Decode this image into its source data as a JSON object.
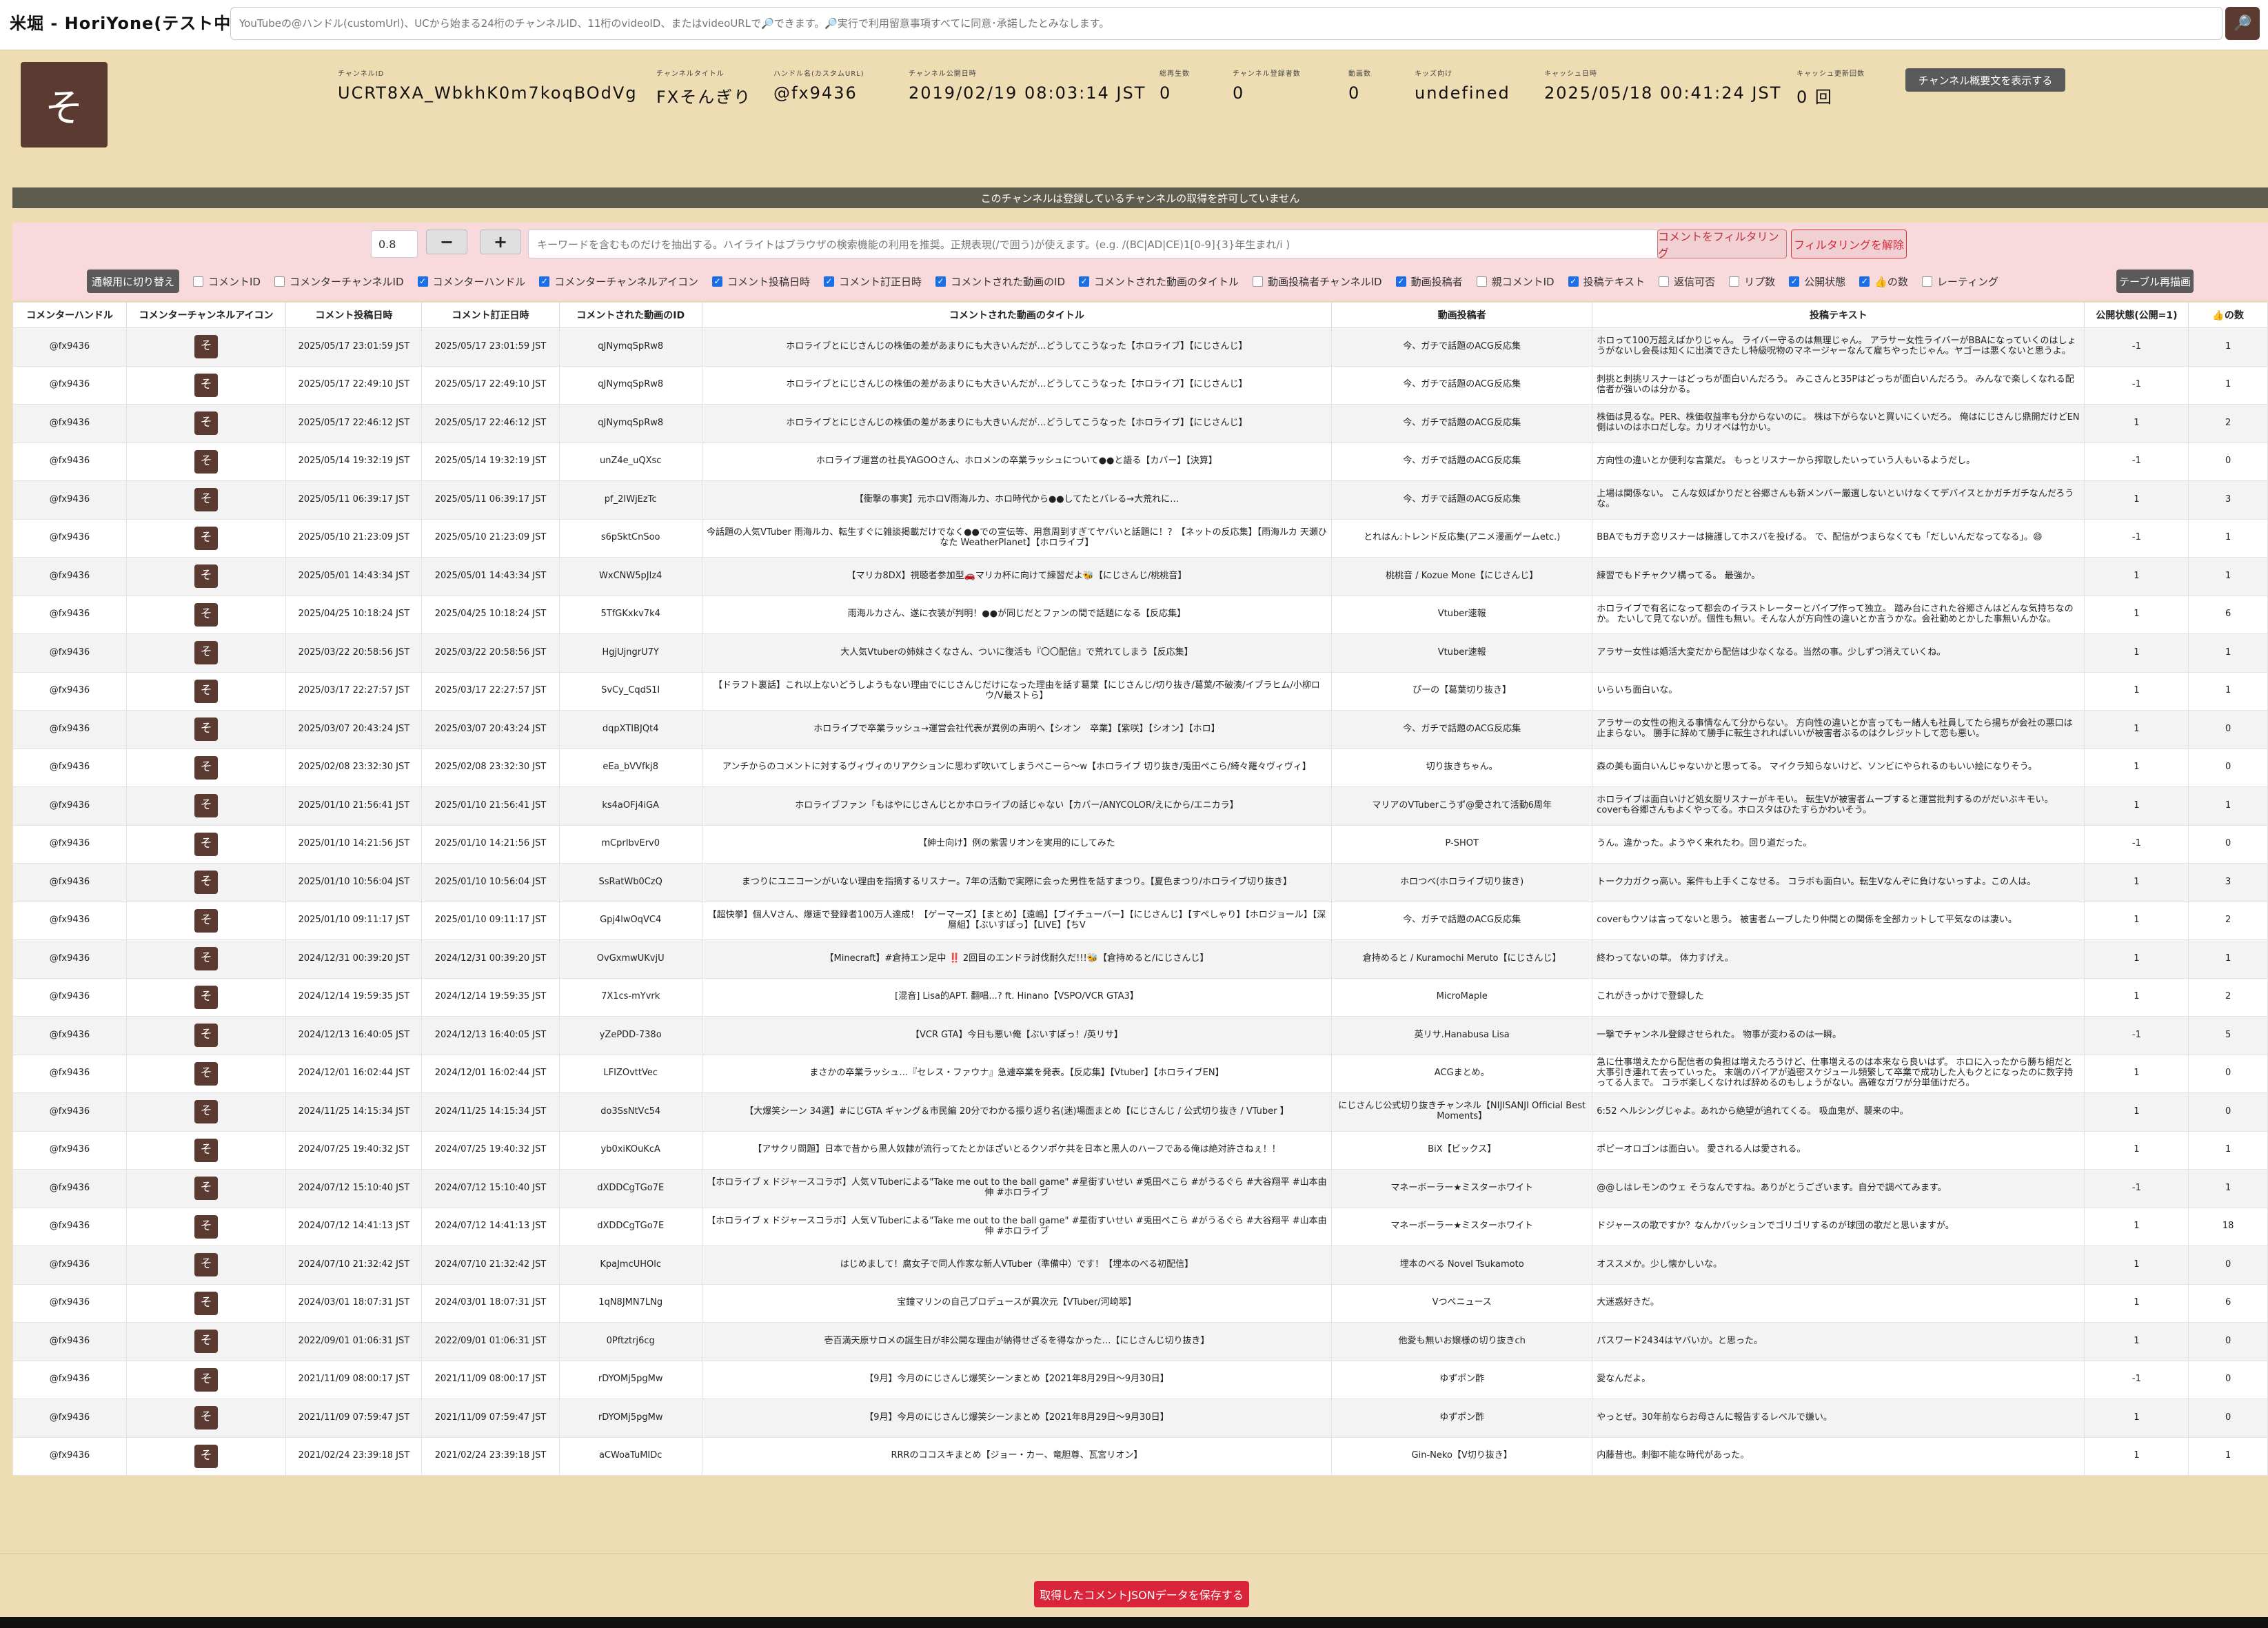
{
  "app_title": "米堀 - HoriYone(テスト中)",
  "search": {
    "placeholder": "YouTubeの@ハンドル(customUrl)、UCから始まる24桁のチャンネルID、11桁のvideoID、またはvideoURLで🔎できます。🔎実行で利用留意事項すべてに同意･承諾したとみなします。",
    "button_icon": "🔎"
  },
  "channel": {
    "avatar_char": "そ",
    "fields": [
      {
        "label": "チャンネルID",
        "value": "UCRT8XA_WbkhK0m7koqBOdVg"
      },
      {
        "label": "チャンネルタイトル",
        "value": "FXそんぎり"
      },
      {
        "label": "ハンドル名(カスタムURL)",
        "value": "@fx9436"
      },
      {
        "label": "チャンネル公開日時",
        "value": "2019/02/19 08:03:14 JST"
      },
      {
        "label": "総再生数",
        "value": "0"
      },
      {
        "label": "チャンネル登録者数",
        "value": "0"
      },
      {
        "label": "動画数",
        "value": "0"
      },
      {
        "label": "キッズ向け",
        "value": "undefined"
      },
      {
        "label": "キャッシュ日時",
        "value": "2025/05/18 00:41:24 JST"
      },
      {
        "label": "キャッシュ更新回数",
        "value": "0 回"
      }
    ],
    "summary_button": "チャンネル概要文を表示する"
  },
  "notice": "このチャンネルは登録しているチャンネルの取得を許可していません",
  "filter": {
    "zoom_value": "0.8",
    "minus_label": "−",
    "plus_label": "+",
    "keyword_placeholder": "キーワードを含むものだけを抽出する。ハイライトはブラウザの検索機能の利用を推奨。正規表現(/で囲う)が使えます。(e.g. /(BC|AD|CE)1[0-9]{3}年生まれ/i )",
    "filter_button": "コメントをフィルタリング",
    "clear_button": "フィルタリングを解除",
    "toggle_button": "通報用に切り替え",
    "redraw_button": "テーブル再描画",
    "columns": [
      {
        "label": "コメントID",
        "checked": false
      },
      {
        "label": "コメンターチャンネルID",
        "checked": false
      },
      {
        "label": "コメンターハンドル",
        "checked": true
      },
      {
        "label": "コメンターチャンネルアイコン",
        "checked": true
      },
      {
        "label": "コメント投稿日時",
        "checked": true
      },
      {
        "label": "コメント訂正日時",
        "checked": true
      },
      {
        "label": "コメントされた動画のID",
        "checked": true
      },
      {
        "label": "コメントされた動画のタイトル",
        "checked": true
      },
      {
        "label": "動画投稿者チャンネルID",
        "checked": false
      },
      {
        "label": "動画投稿者",
        "checked": true
      },
      {
        "label": "親コメントID",
        "checked": false
      },
      {
        "label": "投稿テキスト",
        "checked": true
      },
      {
        "label": "返信可否",
        "checked": false
      },
      {
        "label": "リプ数",
        "checked": false
      },
      {
        "label": "公開状態",
        "checked": true
      },
      {
        "label": "👍の数",
        "checked": true
      },
      {
        "label": "レーティング",
        "checked": false
      }
    ]
  },
  "table": {
    "headers": [
      "コメンターハンドル",
      "コメンターチャンネルアイコン",
      "コメント投稿日時",
      "コメント訂正日時",
      "コメントされた動画のID",
      "コメントされた動画のタイトル",
      "動画投稿者",
      "投稿テキスト",
      "公開状態(公開=1)",
      "👍の数"
    ],
    "rows": [
      {
        "handle": "@fx9436",
        "icon": "そ",
        "posted": "2025/05/17 23:01:59 JST",
        "edited": "2025/05/17 23:01:59 JST",
        "video_id": "qJNymqSpRw8",
        "title": "ホロライブとにじさんじの株価の差があまりにも大きいんだが…どうしてこうなった【ホロライブ】【にじさんじ】",
        "uploader": "今、ガチで話題のACG反応集",
        "text": "ホロって100万超えばかりじゃん。 ライバー守るのは無理じゃん。 アラサー女性ライバーがBBAになっていくのはしょうがないし会長は知くに出演できたし特級呪物のマネージャーなんて雇ちやったじゃん。ヤゴーは悪くないと思うよ。",
        "status": "-1",
        "likes": "1"
      },
      {
        "handle": "@fx9436",
        "icon": "そ",
        "posted": "2025/05/17 22:49:10 JST",
        "edited": "2025/05/17 22:49:10 JST",
        "video_id": "qJNymqSpRw8",
        "title": "ホロライブとにじさんじの株価の差があまりにも大きいんだが…どうしてこうなった【ホロライブ】【にじさんじ】",
        "uploader": "今、ガチで話題のACG反応集",
        "text": "刺挑と刺挑リスナーはどっちが面白いんだろう。 みこさんと35Pはどっちが面白いんだろう。 みんなで楽しくなれる配信者が強いのは分かる。",
        "status": "-1",
        "likes": "1"
      },
      {
        "handle": "@fx9436",
        "icon": "そ",
        "posted": "2025/05/17 22:46:12 JST",
        "edited": "2025/05/17 22:46:12 JST",
        "video_id": "qJNymqSpRw8",
        "title": "ホロライブとにじさんじの株価の差があまりにも大きいんだが…どうしてこうなった【ホロライブ】【にじさんじ】",
        "uploader": "今、ガチで話題のACG反応集",
        "text": "株価は見るな。PER、株価収益率も分からないのに。 株は下がらないと買いにくいだろ。 俺はにじさんじ鼎開だけどEN側はいのはホロだしな。カリオペは竹かい。",
        "status": "1",
        "likes": "2"
      },
      {
        "handle": "@fx9436",
        "icon": "そ",
        "posted": "2025/05/14 19:32:19 JST",
        "edited": "2025/05/14 19:32:19 JST",
        "video_id": "unZ4e_uQXsc",
        "title": "ホロライブ運営の社長YAGOOさん、ホロメンの卒業ラッシュについて●●と語る【カバー】【決算】",
        "uploader": "今、ガチで話題のACG反応集",
        "text": "方向性の違いとか便利な言葉だ。 もっとリスナーから搾取したいっていう人もいるようだし。",
        "status": "-1",
        "likes": "0"
      },
      {
        "handle": "@fx9436",
        "icon": "そ",
        "posted": "2025/05/11 06:39:17 JST",
        "edited": "2025/05/11 06:39:17 JST",
        "video_id": "pf_2IWjEzTc",
        "title": "【衝撃の事実】元ホロV雨海ルカ、ホロ時代から●●してたとバレる→大荒れに…",
        "uploader": "今、ガチで話題のACG反応集",
        "text": "上場は関係ない。 こんな奴ばかりだと谷郷さんも新メンバー厳選しないといけなくてデバイスとかガチガチなんだろうな。",
        "status": "1",
        "likes": "3"
      },
      {
        "handle": "@fx9436",
        "icon": "そ",
        "posted": "2025/05/10 21:23:09 JST",
        "edited": "2025/05/10 21:23:09 JST",
        "video_id": "s6pSktCnSoo",
        "title": "今話題の人気VTuber 雨海ルカ、転生すぐに雑談掲載だけでなく●●での宣伝等、用意周到すぎてヤバいと話題に！？【ネットの反応集】【雨海ルカ 天瀬ひなた WeatherPlanet】【ホロライブ】",
        "uploader": "とれはん:トレンド反応集(アニメ漫画ゲームetc.)",
        "text": "BBAでもガチ恋リスナーは擁護してホスバを投げる。 で、配信がつまらなくても「だしいんだなってなる」。😄",
        "status": "-1",
        "likes": "1"
      },
      {
        "handle": "@fx9436",
        "icon": "そ",
        "posted": "2025/05/01 14:43:34 JST",
        "edited": "2025/05/01 14:43:34 JST",
        "video_id": "WxCNW5pJlz4",
        "title": "【マリカ8DX】視聴者参加型🚗マリカ杯に向けて練習だよ🐝【にじさんじ/桃桃音】",
        "uploader": "桃桃音 / Kozue Mone【にじさんじ】",
        "text": "練習でもドチャクソ構ってる。 最強か。",
        "status": "1",
        "likes": "1"
      },
      {
        "handle": "@fx9436",
        "icon": "そ",
        "posted": "2025/04/25 10:18:24 JST",
        "edited": "2025/04/25 10:18:24 JST",
        "video_id": "5TfGKxkv7k4",
        "title": "雨海ルカさん、遂に衣装が判明！●●が同じだとファンの間で話題になる【反応集】",
        "uploader": "Vtuber速報",
        "text": "ホロライブで有名になって都会のイラストレーターとパイプ作って独立。 踏み台にされた谷郷さんはどんな気持ちなのか。 たいして見てないが。個性も無い。そんな人が方向性の違いとか言うかな。会社勤めとかした事無いんかな。",
        "status": "1",
        "likes": "6"
      },
      {
        "handle": "@fx9436",
        "icon": "そ",
        "posted": "2025/03/22 20:58:56 JST",
        "edited": "2025/03/22 20:58:56 JST",
        "video_id": "HgjUjngrU7Y",
        "title": "大人気Vtuberの姉妹さくなさん、ついに復活も『〇〇配信』で荒れてしまう【反応集】",
        "uploader": "Vtuber速報",
        "text": "アラサー女性は婚活大変だから配信は少なくなる。当然の事。少しずつ消えていくね。",
        "status": "1",
        "likes": "1"
      },
      {
        "handle": "@fx9436",
        "icon": "そ",
        "posted": "2025/03/17 22:27:57 JST",
        "edited": "2025/03/17 22:27:57 JST",
        "video_id": "SvCy_CqdS1I",
        "title": "【ドラフト裏話】これ以上ないどうしようもない理由でにじさんじだけになった理由を話す葛葉【にじさんじ/切り抜き/葛葉/不破湊/イブラヒム/小柳ロウ/V最ストら】",
        "uploader": "ぴーの【葛葉切り抜き】",
        "text": "いらいち面白いな。",
        "status": "1",
        "likes": "1"
      },
      {
        "handle": "@fx9436",
        "icon": "そ",
        "posted": "2025/03/07 20:43:24 JST",
        "edited": "2025/03/07 20:43:24 JST",
        "video_id": "dqpXTIBJQt4",
        "title": "ホロライブで卒業ラッシュ→運営会社代表が異例の声明へ【シオン　卒業】【紫咲】【シオン】【ホロ】",
        "uploader": "今、ガチで話題のACG反応集",
        "text": "アラサーの女性の抱える事情なんて分からない。 方向性の違いとか言ってもー緒人も社員してたら揚ちが会社の悪口は止まらない。 勝手に辞めて勝手に転生されればいいが被害者ぶるのはクレジットして恋も悪い。",
        "status": "1",
        "likes": "0"
      },
      {
        "handle": "@fx9436",
        "icon": "そ",
        "posted": "2025/02/08 23:32:30 JST",
        "edited": "2025/02/08 23:32:30 JST",
        "video_id": "eEa_bVVfkj8",
        "title": "アンチからのコメントに対するヴィヴィのリアクションに思わず吹いてしまうぺこーら〜w【ホロライブ 切り抜き/兎田ぺこら/綺々羅々ヴィヴィ】",
        "uploader": "切り抜きちゃん。",
        "text": "森の美も面白いんじゃないかと思ってる。 マイクラ知らないけど、ソンビにやられるのもいい絵になりそう。",
        "status": "1",
        "likes": "0"
      },
      {
        "handle": "@fx9436",
        "icon": "そ",
        "posted": "2025/01/10 21:56:41 JST",
        "edited": "2025/01/10 21:56:41 JST",
        "video_id": "ks4aOFj4iGA",
        "title": "ホロライブファン「もはやにじさんじとかホロライブの話じゃない【カバー/ANYCOLOR/えにから/エニカラ】",
        "uploader": "マリアのVTuberこうず@愛されて活動6周年",
        "text": "ホロライブは面白いけど処女厨リスナーがキモい。 転生Vが被害者ムーブすると運営批判するのがだいぶキモい。 coverも谷郷さんもよくやってる。ホロスタはひたすらかわいそう。",
        "status": "1",
        "likes": "1"
      },
      {
        "handle": "@fx9436",
        "icon": "そ",
        "posted": "2025/01/10 14:21:56 JST",
        "edited": "2025/01/10 14:21:56 JST",
        "video_id": "mCprIbvErv0",
        "title": "【紳士向け】例の紫雲リオンを実用的にしてみた",
        "uploader": "P-SHOT",
        "text": "うん。違かった。ようやく来れたわ。回り道だった。",
        "status": "-1",
        "likes": "0"
      },
      {
        "handle": "@fx9436",
        "icon": "そ",
        "posted": "2025/01/10 10:56:04 JST",
        "edited": "2025/01/10 10:56:04 JST",
        "video_id": "SsRatWb0CzQ",
        "title": "まつりにユニコーンがいない理由を指摘するリスナー。7年の活動で実際に会った男性を話すまつり。【夏色まつり/ホロライブ切り抜き】",
        "uploader": "ホロつべ(ホロライブ切り抜き)",
        "text": "トーク力ガクっ高い。案件も上手くこなせる。 コラボも面白い。転生Vなんぞに負けないっすよ。この人は。",
        "status": "1",
        "likes": "3"
      },
      {
        "handle": "@fx9436",
        "icon": "そ",
        "posted": "2025/01/10 09:11:17 JST",
        "edited": "2025/01/10 09:11:17 JST",
        "video_id": "Gpj4lwOqVC4",
        "title": "【超快挙】個人Vさん、爆速で登録者100万人達成！【ゲーマーズ】【まとめ】【遠嶋】【ブイチューバー】【にじさんじ】【すぺしゃり】【ホロジョール】【深層組】【ぶいすぽっ】【LIVE】【ちV",
        "uploader": "今、ガチで話題のACG反応集",
        "text": "coverもウソは言ってないと思う。 被害者ムーブしたり仲間との関係を全部カットして平気なのは凄い。",
        "status": "1",
        "likes": "2"
      },
      {
        "handle": "@fx9436",
        "icon": "そ",
        "posted": "2024/12/31 00:39:20 JST",
        "edited": "2024/12/31 00:39:20 JST",
        "video_id": "OvGxmwUKvjU",
        "title": "【Minecraft】#倉持エン足中 ‼️ 2回目のエンドラ討伐耐久だ!!!🐝【倉持めると/にじさんじ】",
        "uploader": "倉持めると / Kuramochi Meruto【にじさんじ】",
        "text": "終わってないの草。 体力すげえ。",
        "status": "1",
        "likes": "1"
      },
      {
        "handle": "@fx9436",
        "icon": "そ",
        "posted": "2024/12/14 19:59:35 JST",
        "edited": "2024/12/14 19:59:35 JST",
        "video_id": "7X1cs-mYvrk",
        "title": "[混音] Lisa的APT. 翻唱...? ft. Hinano【VSPO/VCR GTA3】",
        "uploader": "MicroMaple",
        "text": "これがきっかけで登録した",
        "status": "1",
        "likes": "2"
      },
      {
        "handle": "@fx9436",
        "icon": "そ",
        "posted": "2024/12/13 16:40:05 JST",
        "edited": "2024/12/13 16:40:05 JST",
        "video_id": "yZePDD-738o",
        "title": "【VCR GTA】今日も悪い俺【ぶいすぽっ！/英リサ】",
        "uploader": "英リサ.Hanabusa Lisa",
        "text": "一撃でチャンネル登録させられた。 物事が変わるのは一瞬。",
        "status": "-1",
        "likes": "5"
      },
      {
        "handle": "@fx9436",
        "icon": "そ",
        "posted": "2024/12/01 16:02:44 JST",
        "edited": "2024/12/01 16:02:44 JST",
        "video_id": "LFIZOvttVec",
        "title": "まさかの卒業ラッシュ…『セレス・ファウナ』急遽卒業を発表。【反応集】【Vtuber】【ホロライブEN】",
        "uploader": "ACGまとめ。",
        "text": "急に仕事増えたから配信者の負担は増えたろうけど、仕事増えるのは本来なら良いはず。 ホロに入ったから勝ち組だと大事引き連れて去っていった。 末端のバイアが過密スケジュール頻繁して卒業で成功した人もクとになったのに数字持ってる人まで。 コラボ楽しくなければ辞めるのもしょうがない。高確なガワが分単価けだろ。",
        "status": "1",
        "likes": "0"
      },
      {
        "handle": "@fx9436",
        "icon": "そ",
        "posted": "2024/11/25 14:15:34 JST",
        "edited": "2024/11/25 14:15:34 JST",
        "video_id": "do3SsNtVc54",
        "title": "【大爆笑シーン 34選】#にじGTA ギャング＆市民編 20分でわかる振り返り名(迷)場面まとめ【にじさんじ / 公式切り抜き / VTuber 】",
        "uploader": "にじさんじ公式切り抜きチャンネル【NIJISANJI Official Best Moments】",
        "text": "6:52 ヘルシングじゃよ。あれから絶望が追れてくる。 吸血鬼が、襲来の中。",
        "status": "1",
        "likes": "0"
      },
      {
        "handle": "@fx9436",
        "icon": "そ",
        "posted": "2024/07/25 19:40:32 JST",
        "edited": "2024/07/25 19:40:32 JST",
        "video_id": "yb0xiKOuKcA",
        "title": "【アサクリ問題】日本で昔から黒人奴隷が流行ってたとかほざいとるクソポケ共を日本と黒人のハーフである俺は絶対許さねぇ！！",
        "uploader": "BiX【ビックス】",
        "text": "ポピーオロゴンは面白い。 愛される人は愛される。",
        "status": "1",
        "likes": "1"
      },
      {
        "handle": "@fx9436",
        "icon": "そ",
        "posted": "2024/07/12 15:10:40 JST",
        "edited": "2024/07/12 15:10:40 JST",
        "video_id": "dXDDCgTGo7E",
        "title": "【ホロライブ x ドジャースコラボ】人気ＶTuberによる\"Take me out to the ball game\" #星街すいせい #兎田ぺこら #がうるぐら #大谷翔平 #山本由伸 #ホロライブ",
        "uploader": "マネーボーラー★ミスターホワイト",
        "text": "@@しはレモンのウェ そうなんですね。ありがとうございます。自分で調べてみます。",
        "status": "-1",
        "likes": "1"
      },
      {
        "handle": "@fx9436",
        "icon": "そ",
        "posted": "2024/07/12 14:41:13 JST",
        "edited": "2024/07/12 14:41:13 JST",
        "video_id": "dXDDCgTGo7E",
        "title": "【ホロライブ x ドジャースコラボ】人気ＶTuberによる\"Take me out to the ball game\" #星街すいせい #兎田ぺこら #がうるぐら #大谷翔平 #山本由伸 #ホロライブ",
        "uploader": "マネーボーラー★ミスターホワイト",
        "text": "ドジャースの歌ですか？なんかバッションでゴリゴリするのが球団の歌だと思いますが。",
        "status": "1",
        "likes": "18"
      },
      {
        "handle": "@fx9436",
        "icon": "そ",
        "posted": "2024/07/10 21:32:42 JST",
        "edited": "2024/07/10 21:32:42 JST",
        "video_id": "KpaJmcUHOlc",
        "title": "はじめまして！腐女子で同人作家な新人VTuber（準備中）です！【埋本のべる初配信】",
        "uploader": "埋本のべる Novel Tsukamoto",
        "text": "オススメか。少し懐かしいな。",
        "status": "1",
        "likes": "0"
      },
      {
        "handle": "@fx9436",
        "icon": "そ",
        "posted": "2024/03/01 18:07:31 JST",
        "edited": "2024/03/01 18:07:31 JST",
        "video_id": "1qN8JMN7LNg",
        "title": "宝鐘マリンの自己プロデュースが異次元【VTuber/河崎翆】",
        "uploader": "Vつべニュース",
        "text": "大迷惑好きだ。",
        "status": "1",
        "likes": "6"
      },
      {
        "handle": "@fx9436",
        "icon": "そ",
        "posted": "2022/09/01 01:06:31 JST",
        "edited": "2022/09/01 01:06:31 JST",
        "video_id": "0Pftztrj6cg",
        "title": "壱百満天原サロメの誕生日が非公開な理由が納得せざるを得なかった…【にじさんじ切り抜き】",
        "uploader": "他愛も無いお嬢様の切り抜きch",
        "text": "パスワード2434はヤバいか。と思った。",
        "status": "1",
        "likes": "0"
      },
      {
        "handle": "@fx9436",
        "icon": "そ",
        "posted": "2021/11/09 08:00:17 JST",
        "edited": "2021/11/09 08:00:17 JST",
        "video_id": "rDYOMj5pgMw",
        "title": "【9月】今月のにじさんじ爆笑シーンまとめ【2021年8月29日～9月30日】",
        "uploader": "ゆずポン酢",
        "text": "愛なんだよ。",
        "status": "-1",
        "likes": "0"
      },
      {
        "handle": "@fx9436",
        "icon": "そ",
        "posted": "2021/11/09 07:59:47 JST",
        "edited": "2021/11/09 07:59:47 JST",
        "video_id": "rDYOMj5pgMw",
        "title": "【9月】今月のにじさんじ爆笑シーンまとめ【2021年8月29日～9月30日】",
        "uploader": "ゆずポン酢",
        "text": "やっとぜ。30年前ならお母さんに報告するレベルで嫌い。",
        "status": "1",
        "likes": "0"
      },
      {
        "handle": "@fx9436",
        "icon": "そ",
        "posted": "2021/02/24 23:39:18 JST",
        "edited": "2021/02/24 23:39:18 JST",
        "video_id": "aCWoaTuMIDc",
        "title": "RRRのココスキまとめ【ジョー・カー、竜胆尊、瓦宮リオン】",
        "uploader": "Gin-Neko【V切り抜き】",
        "text": "内藤昔也。刺御不能な時代があった。",
        "status": "1",
        "likes": "1"
      }
    ]
  },
  "footer": {
    "save_button": "取得したコメントJSONデータを保存する"
  }
}
